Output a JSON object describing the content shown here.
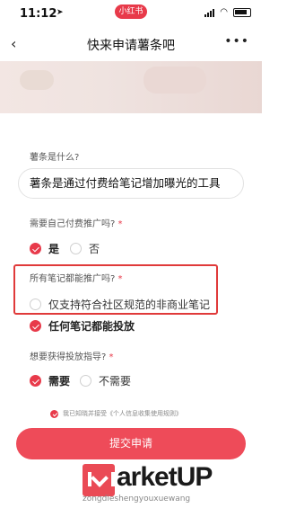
{
  "status_bar": {
    "time": "11:12",
    "app_badge": "小红书"
  },
  "nav": {
    "back_glyph": "‹",
    "title": "快来申请薯条吧",
    "more_glyph": "•••"
  },
  "q1": {
    "label": "薯条是什么?",
    "answer": "薯条是通过付费给笔记增加曝光的工具"
  },
  "q2": {
    "label": "需要自己付费推广吗?",
    "required_mark": "*",
    "options": [
      {
        "text": "是",
        "selected": true
      },
      {
        "text": "否",
        "selected": false
      }
    ]
  },
  "q3": {
    "label": "所有笔记都能推广吗?",
    "required_mark": "*",
    "options": [
      {
        "text": "仅支持符合社区规范的非商业笔记",
        "selected": false
      },
      {
        "text": "任何笔记都能投放",
        "selected": true
      }
    ]
  },
  "q4": {
    "label": "想要获得投放指导?",
    "required_mark": "*",
    "options": [
      {
        "text": "需要",
        "selected": true
      },
      {
        "text": "不需要",
        "selected": false
      }
    ]
  },
  "consent": {
    "text": "我已知晓并接受《个人信息收集使用规则》",
    "checked": true
  },
  "submit_label": "提交申请",
  "watermark": {
    "brand": "arketUP",
    "sub": "zongdieshengyouxuewang"
  },
  "colors": {
    "accent": "#e83a4a",
    "highlight": "#e03a3a"
  }
}
